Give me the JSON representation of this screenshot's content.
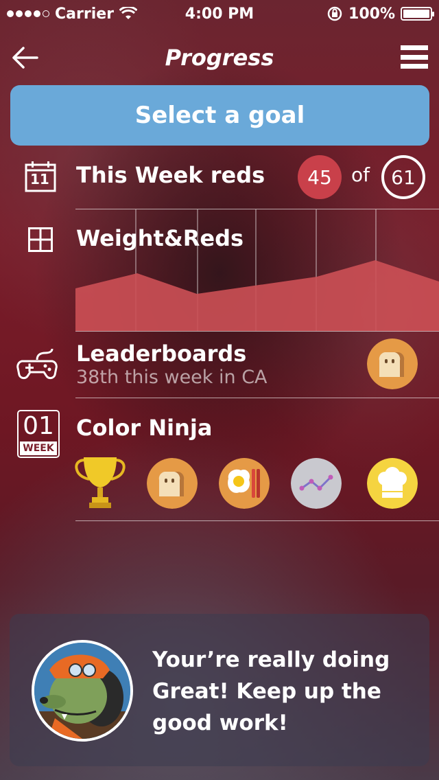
{
  "status_bar": {
    "carrier": "Carrier",
    "time": "4:00 PM",
    "battery": "100%"
  },
  "nav": {
    "title": "Progress",
    "back_icon": "arrow-left-icon",
    "menu_icon": "hamburger-menu-icon"
  },
  "goal_button": {
    "label": "Select a goal",
    "color": "#6aa9d9"
  },
  "this_week": {
    "icon_text": "11",
    "title": "This Week reds",
    "current": "45",
    "of_label": "of",
    "total": "61",
    "accent": "#c9404a"
  },
  "weight_reds": {
    "title": "Weight&Reds",
    "icon": "grid-icon",
    "chart_data": {
      "type": "area",
      "series": [
        {
          "values": [
            0.28,
            0.5,
            0.2,
            0.45,
            0.69,
            0.38
          ]
        }
      ],
      "fill": "#cc5055"
    }
  },
  "leaderboards": {
    "title": "Leaderboards",
    "subtitle": "38th this week in CA",
    "icon": "gamepad-icon",
    "badge_icon": "bread-icon"
  },
  "color_ninja": {
    "week_number": "01",
    "week_label": "WEEK",
    "title": "Color Ninja",
    "achievements": [
      {
        "icon": "trophy-icon"
      },
      {
        "icon": "bread-icon"
      },
      {
        "icon": "egg-bacon-icon"
      },
      {
        "icon": "line-graph-icon"
      },
      {
        "icon": "chef-hat-icon"
      }
    ]
  },
  "message": {
    "text": "Your’re really doing Great! Keep up the good work!",
    "avatar_icon": "cartoon-dog-avatar"
  }
}
